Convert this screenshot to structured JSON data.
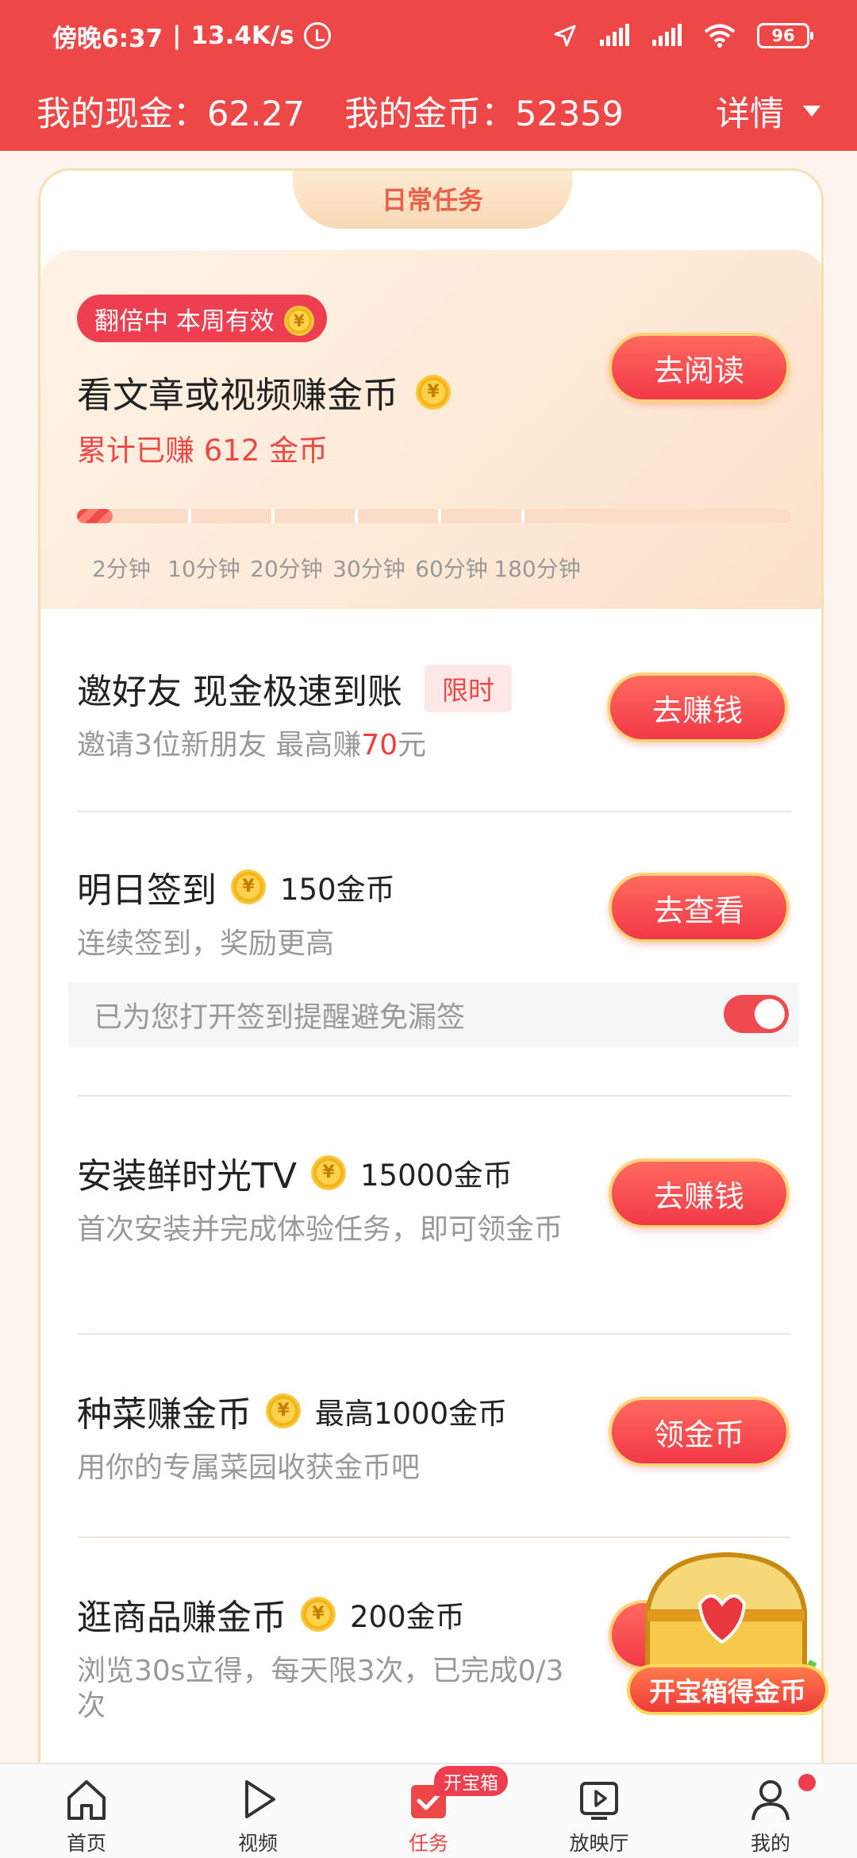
{
  "status_bar": {
    "time": "傍晚6:37",
    "separator": "|",
    "net_speed": "13.4K/s",
    "battery": "96"
  },
  "header": {
    "cash_label": "我的现金：",
    "cash_value": "62.27",
    "coins_label": "我的金币：",
    "coins_value": "52359",
    "detail_label": "详情"
  },
  "card": {
    "tab_title": "日常任务"
  },
  "featured": {
    "badge": "翻倍中 本周有效",
    "title": "看文章或视频赚金币",
    "earned": "累计已赚 612 金币",
    "button": "去阅读",
    "progress_fraction": 0.05,
    "time_labels": [
      "2分钟",
      "10分钟",
      "20分钟",
      "30分钟",
      "60分钟",
      "180分钟"
    ]
  },
  "tasks": [
    {
      "title": "邀好友 现金极速到账",
      "tag": "限时",
      "desc_prefix": "邀请3位新朋友 最高赚",
      "desc_highlight": "70",
      "desc_suffix": "元",
      "button": "去赚钱"
    },
    {
      "title": "明日签到",
      "reward": "150金币",
      "desc": "连续签到，奖励更高",
      "button": "去查看",
      "reminder": "已为您打开签到提醒避免漏签",
      "reminder_on": true
    },
    {
      "title": "安装鲜时光TV",
      "reward": "15000金币",
      "desc": "首次安装并完成体验任务，即可领金币",
      "button": "去赚钱"
    },
    {
      "title": "种菜赚金币",
      "reward": "最高1000金币",
      "desc": "用你的专属菜园收获金币吧",
      "button": "领金币"
    },
    {
      "title": "逛商品赚金币",
      "reward": "200金币",
      "desc": "浏览30s立得，每天限3次，已完成0/3次",
      "button": "去"
    }
  ],
  "treasure": {
    "label": "开宝箱得金币"
  },
  "coin_symbol": "¥",
  "nav": {
    "items": [
      {
        "label": "首页",
        "icon": "home-icon"
      },
      {
        "label": "视频",
        "icon": "play-icon"
      },
      {
        "label": "任务",
        "icon": "task-icon"
      },
      {
        "label": "放映厅",
        "icon": "theater-icon"
      },
      {
        "label": "我的",
        "icon": "profile-icon"
      }
    ],
    "task_badge": "开宝箱"
  },
  "colors": {
    "brand_red": "#ee4747",
    "gold": "#ffd34d"
  }
}
